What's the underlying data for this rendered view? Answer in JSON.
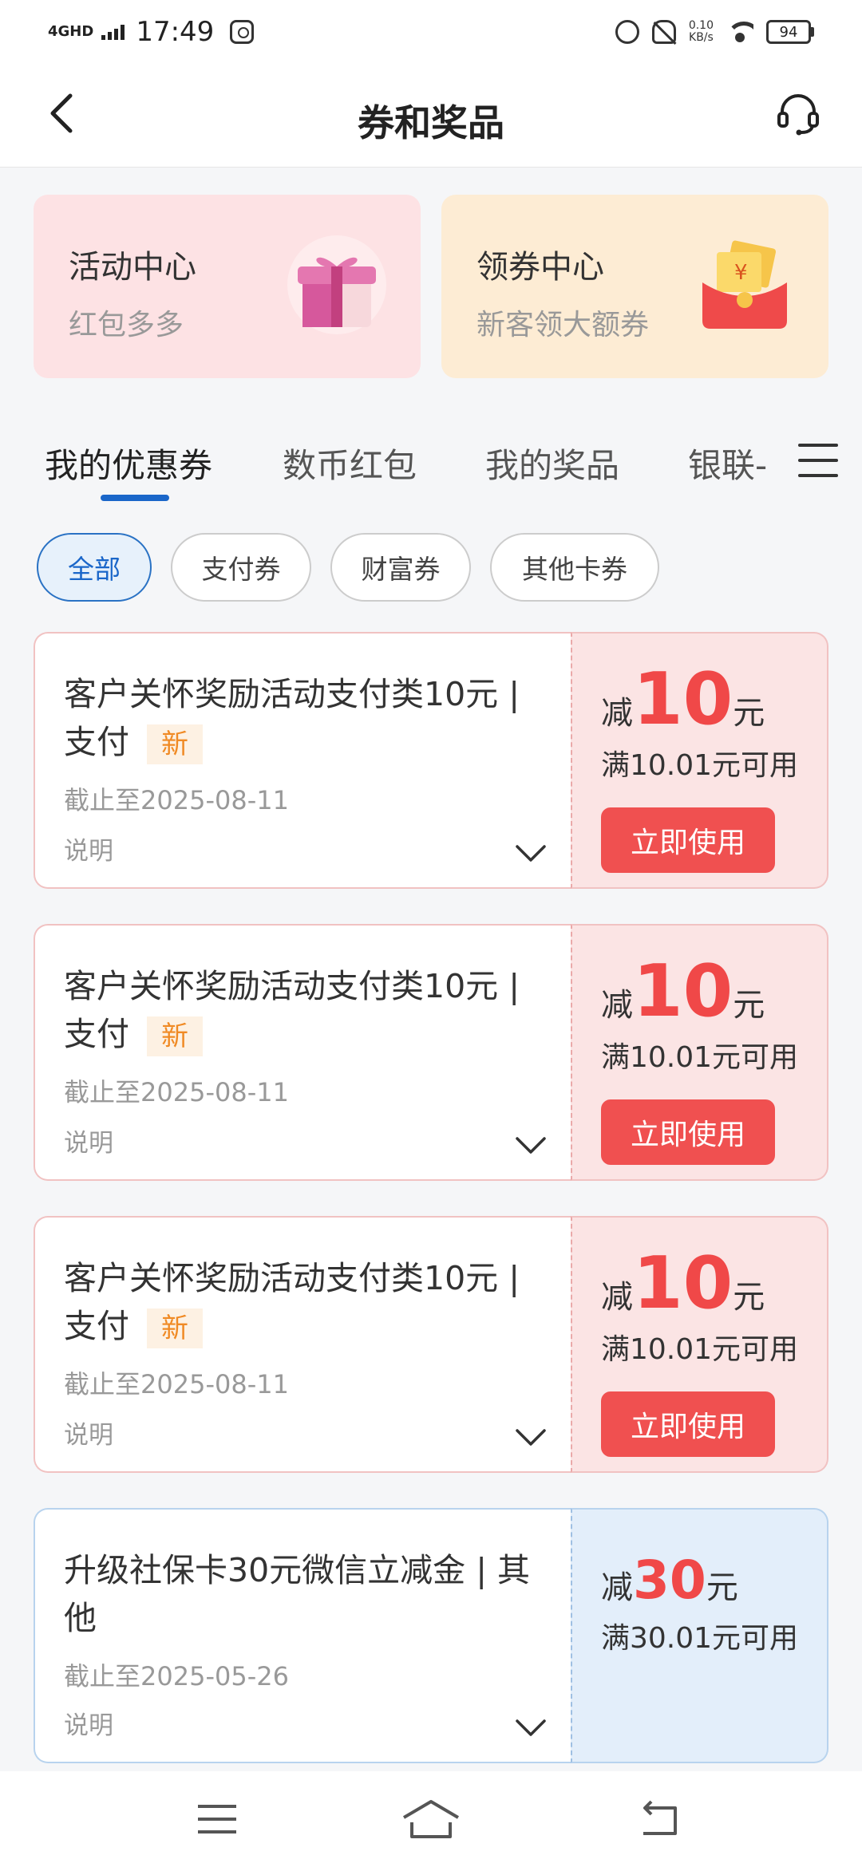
{
  "status_bar": {
    "network": "4GHD",
    "time": "17:49",
    "speed_value": "0.10",
    "speed_unit": "KB/s",
    "battery": "94"
  },
  "header": {
    "title": "券和奖品",
    "back_icon": "chevron-left-icon",
    "service_icon": "headset-icon"
  },
  "entries": [
    {
      "title": "活动中心",
      "subtitle": "红包多多",
      "icon": "gift-box-icon",
      "bg": "#fde2e4"
    },
    {
      "title": "领券中心",
      "subtitle": "新客领大额券",
      "icon": "red-envelope-icon",
      "bg": "#fdecd4"
    }
  ],
  "tabs": [
    {
      "label": "我的优惠券",
      "active": true
    },
    {
      "label": "数币红包",
      "active": false
    },
    {
      "label": "我的奖品",
      "active": false
    },
    {
      "label": "银联-",
      "active": false
    }
  ],
  "filters": [
    {
      "label": "全部",
      "active": true
    },
    {
      "label": "支付券",
      "active": false
    },
    {
      "label": "财富券",
      "active": false
    },
    {
      "label": "其他卡券",
      "active": false
    }
  ],
  "coupons": [
    {
      "title": "客户关怀奖励活动支付类10元 | 支付",
      "tag": "新",
      "expiry": "截止至2025-08-11",
      "desc_label": "说明",
      "prefix": "减",
      "amount": "10",
      "unit": "元",
      "condition": "满10.01元可用",
      "button": "立即使用"
    },
    {
      "title": "客户关怀奖励活动支付类10元 | 支付",
      "tag": "新",
      "expiry": "截止至2025-08-11",
      "desc_label": "说明",
      "prefix": "减",
      "amount": "10",
      "unit": "元",
      "condition": "满10.01元可用",
      "button": "立即使用"
    },
    {
      "title": "客户关怀奖励活动支付类10元 | 支付",
      "tag": "新",
      "expiry": "截止至2025-08-11",
      "desc_label": "说明",
      "prefix": "减",
      "amount": "10",
      "unit": "元",
      "condition": "满10.01元可用",
      "button": "立即使用"
    },
    {
      "title": "升级社保卡30元微信立减金 | 其他",
      "expiry": "截止至2025-05-26",
      "desc_label": "说明",
      "prefix": "减",
      "amount": "30",
      "unit": "元",
      "condition": "满30.01元可用"
    }
  ],
  "colors": {
    "accent_blue": "#1a66c9",
    "coupon_red": "#f04848",
    "new_tag_orange": "#f08a24"
  },
  "nav": {
    "menu_icon": "menu-icon",
    "home_icon": "home-icon",
    "back_icon": "return-icon"
  }
}
